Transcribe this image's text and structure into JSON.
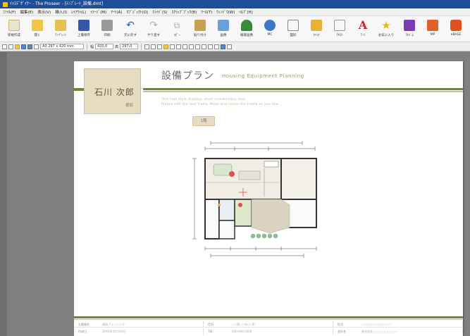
{
  "window": {
    "title": "ｲﾒｽﾃﾞｻﾞｲﾅｰ - The Proseer - [ﾃﾝﾌﾟﾚｰﾄ_設備.dmt]"
  },
  "menu": [
    "ﾌｧｲﾙ(F)",
    "編集(E)",
    "表示(V)",
    "挿入(I)",
    "ﾚｲｱｳﾄ(L)",
    "ｲﾒｰｼﾞ(M)",
    "ｱｰﾄ(A)",
    "ｵﾌﾞｼﾞｪｸﾄ(O)",
    "ｽﾗｲﾄﾞ(S)",
    "ｽｸﾗｯﾌﾟﾌﾞｯｸ(B)",
    "ﾂｰﾙ(T)",
    "ｳｨﾝﾄﾞｳ(W)",
    "ﾍﾙﾌﾟ(H)"
  ],
  "ribbon": [
    {
      "label": "新規作成",
      "icon": "new-doc-icon"
    },
    {
      "label": "開く",
      "icon": "open-folder-icon"
    },
    {
      "label": "ﾃﾝﾌﾟﾚｰﾄ",
      "icon": "template-icon"
    },
    {
      "label": "上書保存",
      "icon": "save-icon"
    },
    {
      "label": "印刷",
      "icon": "print-icon"
    },
    {
      "label": "元に戻す",
      "icon": "undo-icon"
    },
    {
      "label": "やり直す",
      "icon": "redo-icon"
    },
    {
      "label": "ｺﾋﾟｰ",
      "icon": "copy-icon"
    },
    {
      "label": "貼り付け",
      "icon": "paste-icon"
    },
    {
      "label": "画像",
      "icon": "image-icon"
    },
    {
      "label": "植栽画像",
      "icon": "plant-icon"
    },
    {
      "label": "MC",
      "icon": "mc-icon"
    },
    {
      "label": "図形",
      "icon": "shape-icon"
    },
    {
      "label": "ｸｲｯｸ",
      "icon": "quick-icon"
    },
    {
      "label": "ﾃｷｽﾄ",
      "icon": "text-icon"
    },
    {
      "label": "ｱｰﾄ",
      "icon": "art-icon"
    },
    {
      "label": "お気に入り",
      "icon": "favorite-star-icon"
    },
    {
      "label": "ｱﾙﾊﾞﾑ",
      "icon": "album-icon"
    },
    {
      "label": "MP",
      "icon": "mp-icon"
    },
    {
      "label": "eBASE",
      "icon": "ebase-icon"
    }
  ],
  "format_bar": {
    "paper_size": "A3 297 x 420 mm",
    "width_label": "幅",
    "width_value": "420.0",
    "height_label": "高",
    "height_value": "297.0"
  },
  "page": {
    "name_plate": {
      "name": "石川 次郎",
      "role": "様邸"
    },
    "title_jp": "設備プラン",
    "title_en": "Housing Equipment Planning",
    "description": [
      "This text style displays short commentary text.",
      "Please edit the text freely. Move and resize the frame as you like."
    ],
    "floor_tag": "1階",
    "footer": {
      "row1": [
        {
          "label": "お客様名",
          "value": "様邸プランニング"
        },
        {
          "label": "住所",
          "value": "○○県○○市○○町"
        },
        {
          "label": "担当",
          "value": "○○○○○○○○○○○○"
        }
      ],
      "row2": [
        {
          "label": "作成日",
          "value": "20XX年XX月XX日"
        },
        {
          "label": "TEL",
          "value": "000-000-0000"
        },
        {
          "label": "会社名",
          "value": "株式会社○○○○○○○○○○"
        }
      ]
    }
  },
  "colors": {
    "titlebar": "#1e4e9a",
    "accent_green": "#6a8a3a",
    "accent_light": "#b5c98e",
    "plate": "#e7dcc0"
  }
}
